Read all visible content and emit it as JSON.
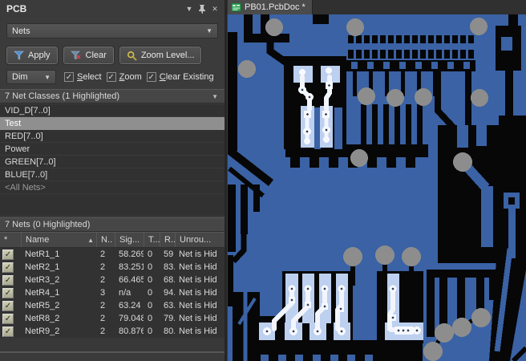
{
  "panel": {
    "title": "PCB",
    "mode_select": {
      "value": "Nets"
    },
    "toolbar": {
      "apply": "Apply",
      "clear": "Clear",
      "zoom_level": "Zoom Level..."
    },
    "options": {
      "dim": "Dim",
      "select": "Select",
      "zoom": "Zoom",
      "clear_existing": "Clear Existing"
    },
    "net_classes": {
      "header": "7 Net Classes (1 Highlighted)",
      "items": [
        "VID_D[7..0]",
        "Test",
        "RED[7..0]",
        "Power",
        "GREEN[7..0]",
        "BLUE[7..0]",
        "<All Nets>"
      ],
      "selected": "Test"
    },
    "nets": {
      "header": "7 Nets (0 Highlighted)",
      "columns": {
        "check": "*",
        "name": "Name",
        "nodes": "N..",
        "signal": "Sig...",
        "t": "T...",
        "routed": "R...",
        "unrouted": "Unrou..."
      },
      "rows": [
        {
          "checked": true,
          "name": "NetR1_1",
          "nodes": "2",
          "signal": "58.269",
          "t": "0",
          "routed": "59",
          "unrouted": "Net is Hid"
        },
        {
          "checked": true,
          "name": "NetR2_1",
          "nodes": "2",
          "signal": "83.251",
          "t": "0",
          "routed": "83.",
          "unrouted": "Net is Hid"
        },
        {
          "checked": true,
          "name": "NetR3_2",
          "nodes": "2",
          "signal": "66.465",
          "t": "0",
          "routed": "68.",
          "unrouted": "Net is Hid"
        },
        {
          "checked": true,
          "name": "NetR4_1",
          "nodes": "3",
          "signal": "n/a",
          "t": "0",
          "routed": "94.",
          "unrouted": "Net is Hid"
        },
        {
          "checked": true,
          "name": "NetR5_2",
          "nodes": "2",
          "signal": "63.24",
          "t": "0",
          "routed": "63.",
          "unrouted": "Net is Hid"
        },
        {
          "checked": true,
          "name": "NetR8_2",
          "nodes": "2",
          "signal": "79.048",
          "t": "0",
          "routed": "79.",
          "unrouted": "Net is Hid"
        },
        {
          "checked": true,
          "name": "NetR9_2",
          "nodes": "2",
          "signal": "80.876",
          "t": "0",
          "routed": "80.",
          "unrouted": "Net is Hid"
        }
      ]
    }
  },
  "editor": {
    "tab": "PB01.PcbDoc *"
  },
  "icons": {
    "panel_menu": "▼",
    "close": "✕",
    "dropdown": "▼",
    "collapse": "▼",
    "sort_asc": "▲",
    "check": "✓"
  },
  "colors": {
    "copper_blue": "#3a62a5",
    "board_black": "#070707",
    "via_gray": "#8d8d8d",
    "highlight_pad": "#bdd0ef",
    "highlight_trace": "#f2f5fc",
    "tab_icon_green": "#36a257",
    "apply_funnel_blue": "#4f8fd4",
    "clear_x_red": "#d14040",
    "magnifier_gold": "#d4c04a"
  }
}
